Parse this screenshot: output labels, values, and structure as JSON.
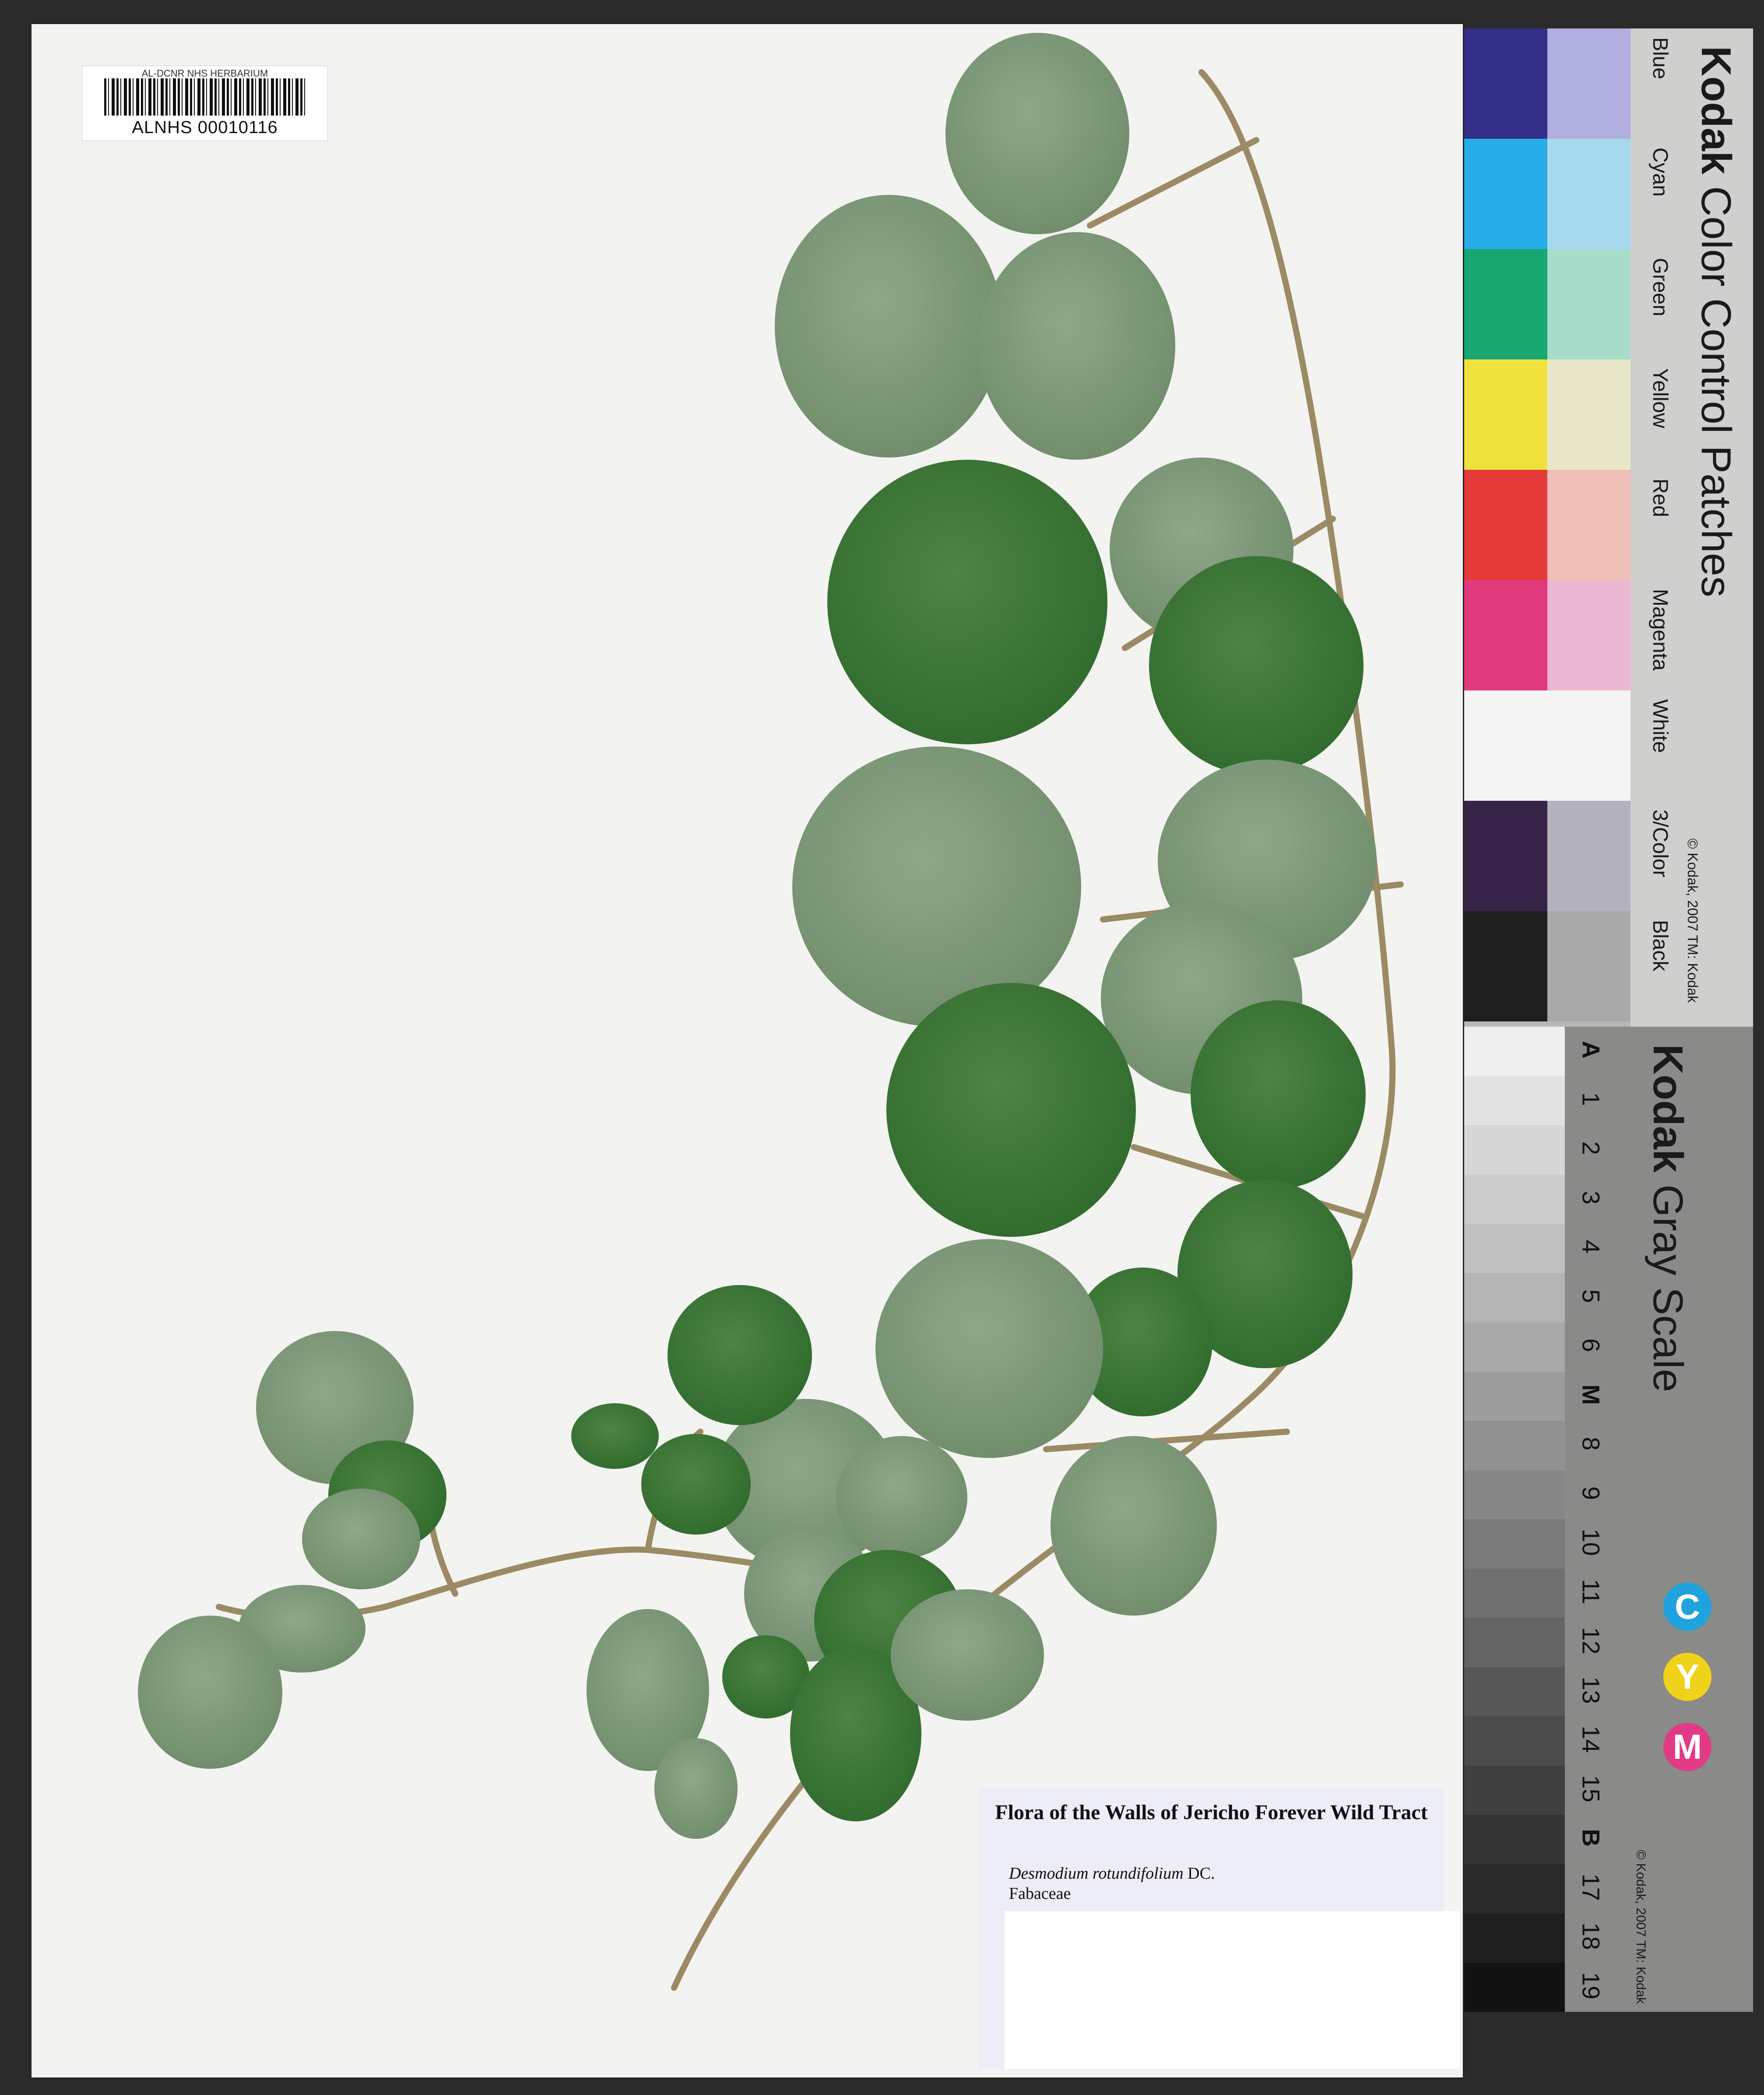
{
  "barcode": {
    "institution": "AL-DCNR NHS HERBARIUM",
    "number": "ALNHS 00010116"
  },
  "label": {
    "title": "Flora of the Walls of Jericho Forever Wild Tract",
    "species": "Desmodium rotundifolium",
    "author": "DC.",
    "family": "Fabaceae"
  },
  "color_card": {
    "brand": "Kodak",
    "title": "Color Control Patches",
    "copyright": "© Kodak, 2007 TM: Kodak",
    "patches": [
      {
        "name": "Blue",
        "dark": "#332e87",
        "light": "#b1aee0"
      },
      {
        "name": "Cyan",
        "dark": "#27aee8",
        "light": "#a7d9ee"
      },
      {
        "name": "Green",
        "dark": "#17a770",
        "light": "#a7dcca"
      },
      {
        "name": "Yellow",
        "dark": "#f0e23d",
        "light": "#e8e8c9"
      },
      {
        "name": "Red",
        "dark": "#e53a39",
        "light": "#f0bfb7"
      },
      {
        "name": "Magenta",
        "dark": "#e1397d",
        "light": "#ecb7d2"
      },
      {
        "name": "White",
        "dark": "#f4f4f4",
        "light": "#f4f4f4"
      },
      {
        "name": "3/Color",
        "dark": "#382449",
        "light": "#b4b1bf"
      },
      {
        "name": "Black",
        "dark": "#1e1e1e",
        "light": "#a9a9a9"
      }
    ]
  },
  "gray_scale": {
    "brand": "Kodak",
    "title": "Gray Scale",
    "copyright": "© Kodak, 2007 TM: Kodak",
    "steps": [
      "A",
      "1",
      "2",
      "3",
      "4",
      "5",
      "6",
      "M",
      "8",
      "9",
      "10",
      "11",
      "12",
      "13",
      "14",
      "15",
      "B",
      "17",
      "18",
      "19"
    ],
    "cym": [
      {
        "letter": "C",
        "color": "#1fa3de"
      },
      {
        "letter": "Y",
        "color": "#f0d21a"
      },
      {
        "letter": "M",
        "color": "#e23a86"
      }
    ]
  }
}
